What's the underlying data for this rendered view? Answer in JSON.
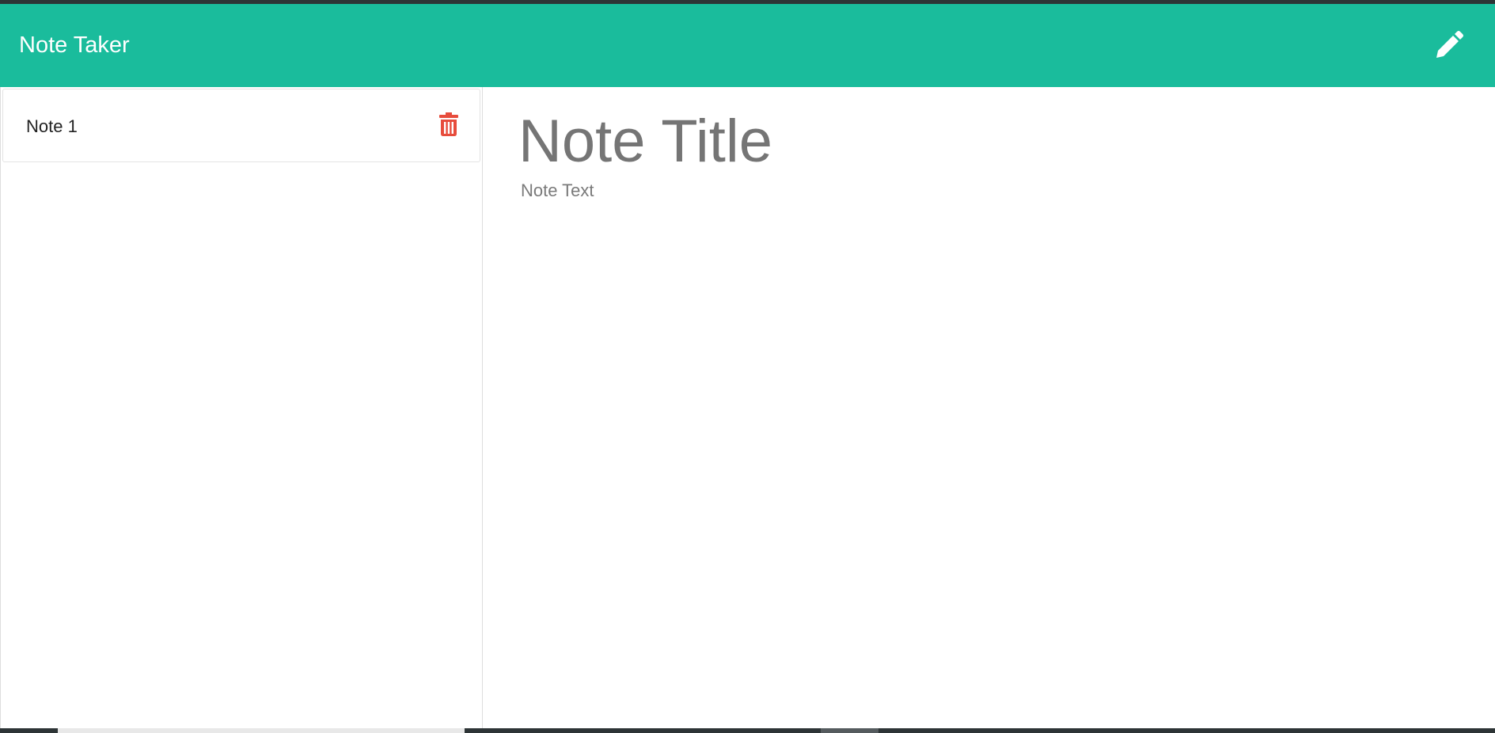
{
  "app": {
    "title": "Note Taker"
  },
  "header": {
    "new_note_icon": "pencil-icon"
  },
  "sidebar": {
    "notes": [
      {
        "title": "Note 1",
        "delete_icon": "trash-icon"
      }
    ]
  },
  "editor": {
    "title_placeholder": "Note Title",
    "text_placeholder": "Note Text"
  },
  "colors": {
    "navbar": "#1abc9c",
    "delete_icon": "#e74c3c",
    "header_text": "#ffffff"
  }
}
